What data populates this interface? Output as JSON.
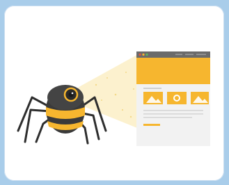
{
  "card": {
    "title": "",
    "illustration": {
      "subject": "robot-spider-crawling-webpage",
      "colors": {
        "background_outer": "#a9cdea",
        "card": "#ffffff",
        "accent_yellow": "#f6b62f",
        "spider_body": "#3a3a3a",
        "browser_chrome": "#6b6b6b",
        "page_panel": "#f2f2f2",
        "light_beam": "#fbeec5"
      }
    }
  }
}
